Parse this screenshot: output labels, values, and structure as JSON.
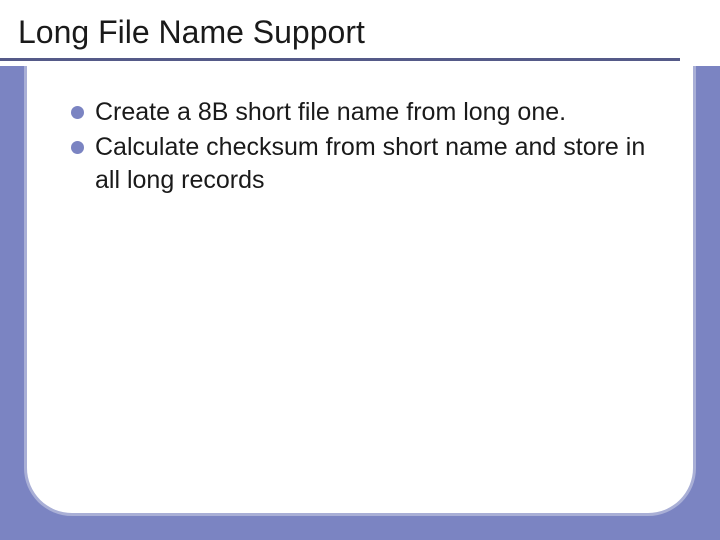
{
  "slide": {
    "title": "Long File Name Support",
    "bullets": [
      "Create a 8B short file name from long one.",
      "Calculate checksum from short name and store in all long records"
    ]
  },
  "theme": {
    "background": "#7b84c2",
    "card_border": "#a9afd6",
    "underline": "#555a88",
    "bullet_color": "#7b84c2"
  }
}
